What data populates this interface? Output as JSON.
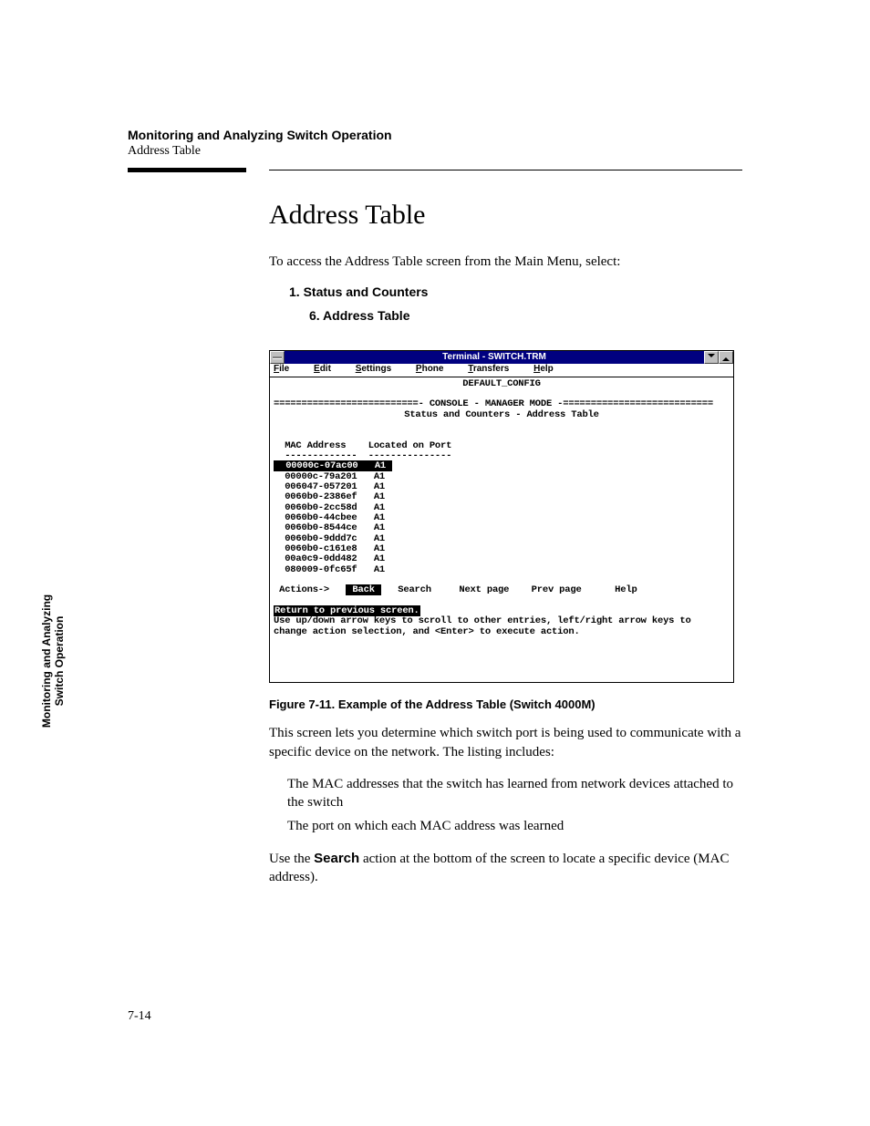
{
  "header": {
    "chapter": "Monitoring and Analyzing Switch Operation",
    "section": "Address Table"
  },
  "title": "Address Table",
  "intro": "To access the Address Table screen from the Main Menu, select:",
  "steps": {
    "s1": "1. Status and Counters",
    "s2": "6. Address Table"
  },
  "terminal": {
    "title": "Terminal - SWITCH.TRM",
    "menus": {
      "file": "File",
      "edit": "Edit",
      "settings": "Settings",
      "phone": "Phone",
      "transfers": "Transfers",
      "help": "Help"
    },
    "body": {
      "config": "DEFAULT_CONFIG",
      "rule": "==========================- CONSOLE - MANAGER MODE -===========================",
      "subtitle": "Status and Counters - Address Table",
      "col_headers": "  MAC Address    Located on Port",
      "col_dashes": "  -------------  ---------------",
      "row_sel": "  00000c-07ac00   A1 ",
      "rows": [
        "  00000c-79a201   A1",
        "  006047-057201   A1",
        "  0060b0-2386ef   A1",
        "  0060b0-2cc58d   A1",
        "  0060b0-44cbee   A1",
        "  0060b0-8544ce   A1",
        "  0060b0-9ddd7c   A1",
        "  0060b0-c161e8   A1",
        "  00a0c9-0dd482   A1",
        "  080009-0fc65f   A1"
      ],
      "actions_label": " Actions->",
      "action_back": " Back ",
      "action_rest": "   Search     Next page    Prev page      Help",
      "prompt_sel": "Return to previous screen.",
      "help_line1": "Use up/down arrow keys to scroll to other entries, left/right arrow keys to",
      "help_line2": "change action selection, and <Enter> to execute action."
    }
  },
  "figure_caption": "Figure 7-11.  Example of the Address Table (Switch 4000M)",
  "para1": "This screen lets you determine which switch port is being used to communicate with a specific device on the network. The listing includes:",
  "bullets": {
    "b1": "The MAC addresses that the switch has learned from network devices attached to the switch",
    "b2": "The port on which each MAC address was learned"
  },
  "para2_pre": "Use the ",
  "para2_bold": "Search",
  "para2_post": " action at the bottom of the screen to locate a specific device (MAC address).",
  "sidetab": {
    "l1": "Monitoring and Analyzing",
    "l2": "Switch Operation"
  },
  "page_number": "7-14"
}
